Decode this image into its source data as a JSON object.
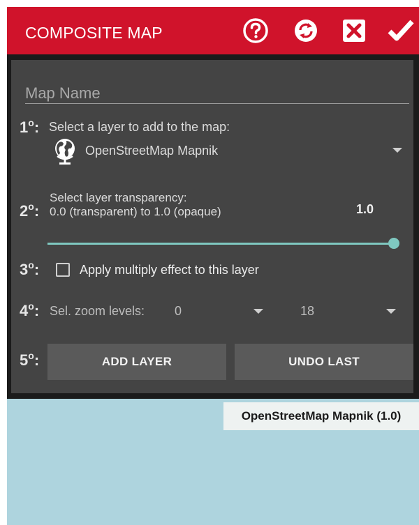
{
  "header": {
    "title": "COMPOSITE MAP",
    "icons": [
      "help-icon",
      "refresh-icon",
      "close-icon",
      "check-icon"
    ],
    "bar_color": "#d0132b"
  },
  "form": {
    "map_name_placeholder": "Map Name",
    "step1": {
      "number": "1",
      "sup": "o",
      "colon": ":",
      "label": "Select a layer to add to the map:",
      "selected_layer": "OpenStreetMap Mapnik",
      "icon": "globe-icon"
    },
    "step2": {
      "number": "2",
      "sup": "o",
      "colon": ":",
      "label_line1": "Select layer transparency:",
      "label_line2": "0.0 (transparent) to 1.0 (opaque)",
      "value": "1.0",
      "slider_fraction": 1.0,
      "accent": "#7fc8c0"
    },
    "step3": {
      "number": "3",
      "sup": "o",
      "colon": ":",
      "label": "Apply multiply effect to this layer",
      "checked": false
    },
    "step4": {
      "number": "4",
      "sup": "o",
      "colon": ":",
      "label": "Sel. zoom levels:",
      "min_zoom": "0",
      "max_zoom": "18"
    },
    "step5": {
      "number": "5",
      "sup": "o",
      "colon": ":",
      "add_label": "ADD LAYER",
      "undo_label": "UNDO LAST"
    }
  },
  "map": {
    "layer_label": "OpenStreetMap Mapnik (1.0)",
    "background_color": "#aed4de"
  }
}
